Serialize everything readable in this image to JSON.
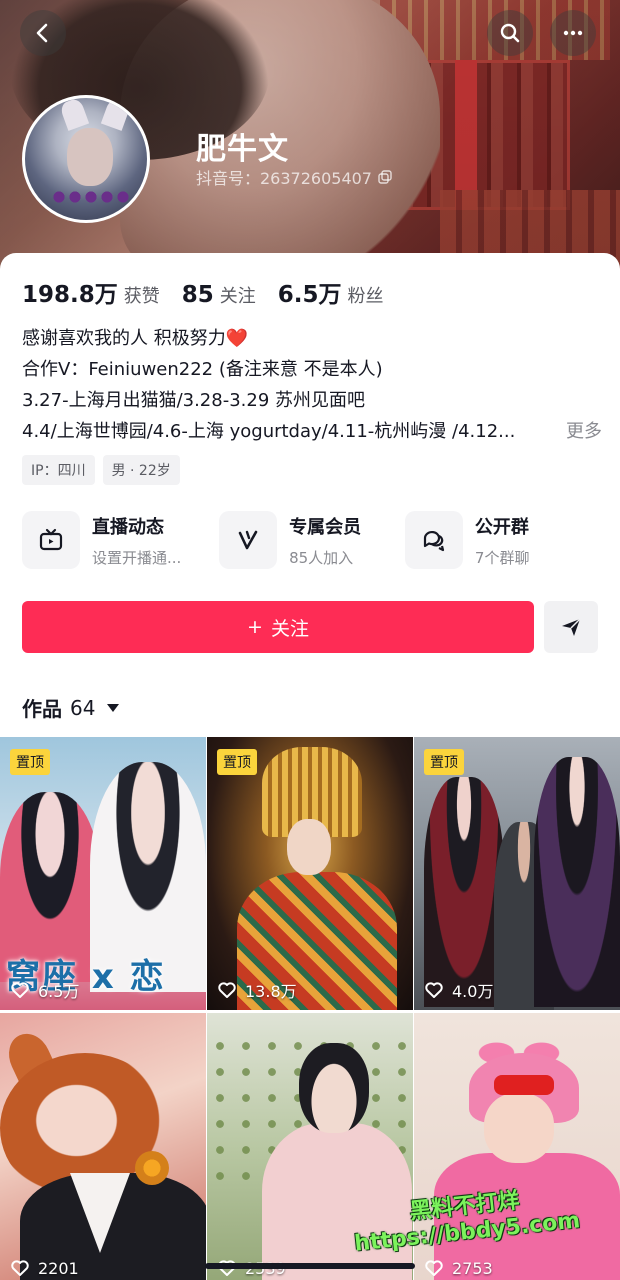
{
  "header": {
    "name": "肥牛文",
    "douyin_id": "抖音号：26372605407"
  },
  "stats": [
    {
      "value": "198.8万",
      "label": "获赞"
    },
    {
      "value": "85",
      "label": "关注"
    },
    {
      "value": "6.5万",
      "label": "粉丝"
    }
  ],
  "bio": {
    "line1": "感谢喜欢我的人   积极努力",
    "line1_emoji": "❤️",
    "line2": "合作V：Feiniuwen222 (备注来意 不是本人)",
    "line3": "3.27-上海月出猫猫/3.28-3.29 苏州见面吧",
    "line4": "4.4/上海世博园/4.6-上海 yogurtday/4.11-杭州屿漫 /4.12...",
    "more": "更多"
  },
  "tags": [
    "IP：四川",
    "男 · 22岁"
  ],
  "features": [
    {
      "title": "直播动态",
      "sub": "设置开播通...",
      "icon": "tv-icon"
    },
    {
      "title": "专属会员",
      "sub": "85人加入",
      "icon": "v-icon"
    },
    {
      "title": "公开群",
      "sub": "7个群聊",
      "icon": "chat-icon"
    }
  ],
  "follow": {
    "label": "关注",
    "plus": "+"
  },
  "works": {
    "label": "作品",
    "count": "64"
  },
  "grid": [
    {
      "pinned": "置顶",
      "likes": "6.5万",
      "caption": "窝座 x 恋"
    },
    {
      "pinned": "置顶",
      "likes": "13.8万"
    },
    {
      "pinned": "置顶",
      "likes": "4.0万"
    },
    {
      "likes": "2201"
    },
    {
      "likes": "2539"
    },
    {
      "likes": "2753"
    }
  ],
  "watermark": {
    "line1": "黑料不打烊",
    "line2": "https://bbdy5.com"
  },
  "colors": {
    "accent": "#fe2c55",
    "pin": "#fbd43c",
    "watermark": "#7cf25c"
  }
}
